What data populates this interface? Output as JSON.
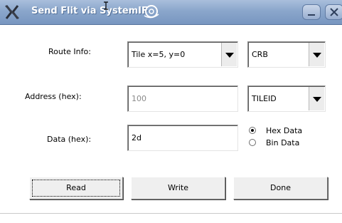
{
  "window": {
    "title": "Send Flit via SystemIF"
  },
  "icons": {
    "app": "x-app-icon",
    "minimize": "minimize-icon",
    "close": "close-icon"
  },
  "form": {
    "route": {
      "label": "Route Info:",
      "tile_value": "Tile x=5, y=0",
      "target_value": "CRB"
    },
    "address": {
      "label": "Address (hex):",
      "value": "100",
      "type_value": "TILEID"
    },
    "data": {
      "label": "Data (hex):",
      "value": "2d",
      "format_options": [
        {
          "label": "Hex Data",
          "checked": true
        },
        {
          "label": "Bin Data",
          "checked": false
        }
      ]
    }
  },
  "buttons": {
    "read": "Read",
    "write": "Write",
    "done": "Done"
  }
}
